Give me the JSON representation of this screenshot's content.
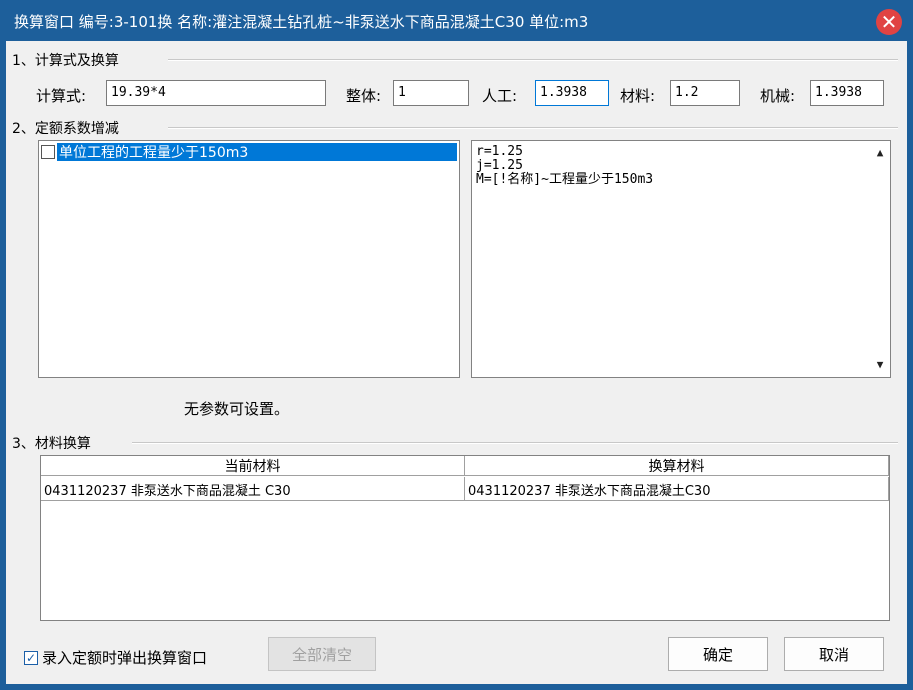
{
  "window": {
    "title": "换算窗口 编号:3-101换 名称:灌注混凝土钻孔桩~非泵送水下商品混凝土C30 单位:m3",
    "close_glyph": "✕"
  },
  "section1": {
    "title": "1、计算式及换算",
    "formula_label": "计算式:",
    "formula_value": "19.39*4",
    "whole_label": "整体:",
    "whole_value": "1",
    "labor_label": "人工:",
    "labor_value": "1.3938",
    "material_label": "材料:",
    "material_value": "1.2",
    "machine_label": "机械:",
    "machine_value": "1.3938"
  },
  "section2": {
    "title": "2、定额系数增减",
    "items": [
      {
        "label": "单位工程的工程量少于150m3",
        "checked": false
      }
    ],
    "detail_lines": [
      "r=1.25",
      "j=1.25",
      "M=[!名称]~工程量少于150m3"
    ],
    "no_params_text": "无参数可设置。"
  },
  "section3": {
    "title": "3、材料换算",
    "columns": [
      "当前材料",
      "换算材料"
    ],
    "rows": [
      [
        "0431120237 非泵送水下商品混凝土 C30",
        "0431120237 非泵送水下商品混凝土C30"
      ]
    ]
  },
  "footer": {
    "popup_checkbox_label": "录入定额时弹出换算窗口",
    "popup_checked": true,
    "clear_all_label": "全部清空",
    "ok_label": "确定",
    "cancel_label": "取消"
  },
  "icons": {
    "checkmark": "✓",
    "scroll_up": "▲",
    "scroll_down": "▼"
  },
  "colors": {
    "titlebar": "#1d5f9b",
    "selection": "#0078d7",
    "close_button": "#e04343"
  }
}
